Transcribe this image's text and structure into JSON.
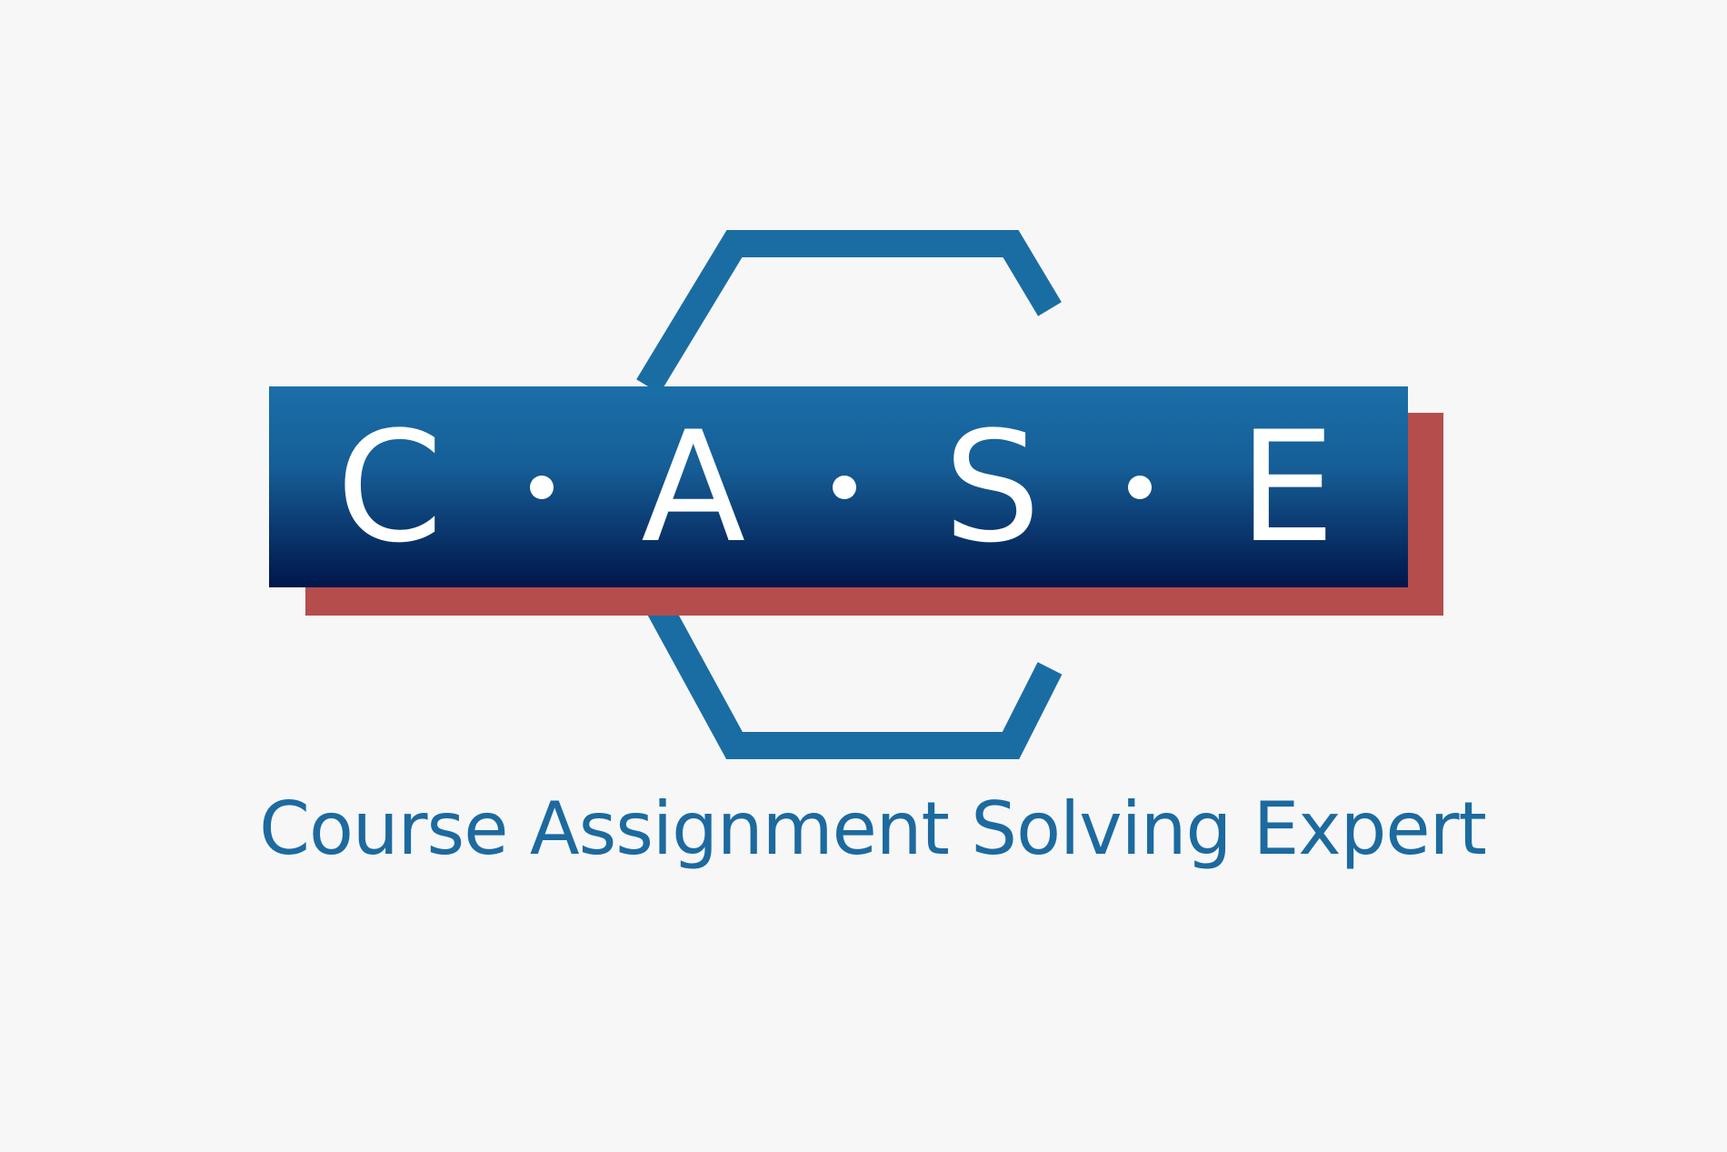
{
  "logo": {
    "letters": [
      "C",
      "A",
      "S",
      "E"
    ],
    "tagline": "Course Assignment Solving Expert",
    "colors": {
      "background": "#f7f7f7",
      "outline_blue": "#1a6da3",
      "bar_top": "#1a6fa8",
      "bar_bottom": "#00164a",
      "shadow_red": "#b54d4d",
      "letter": "#ffffff",
      "tagline": "#1c6a9f"
    }
  }
}
